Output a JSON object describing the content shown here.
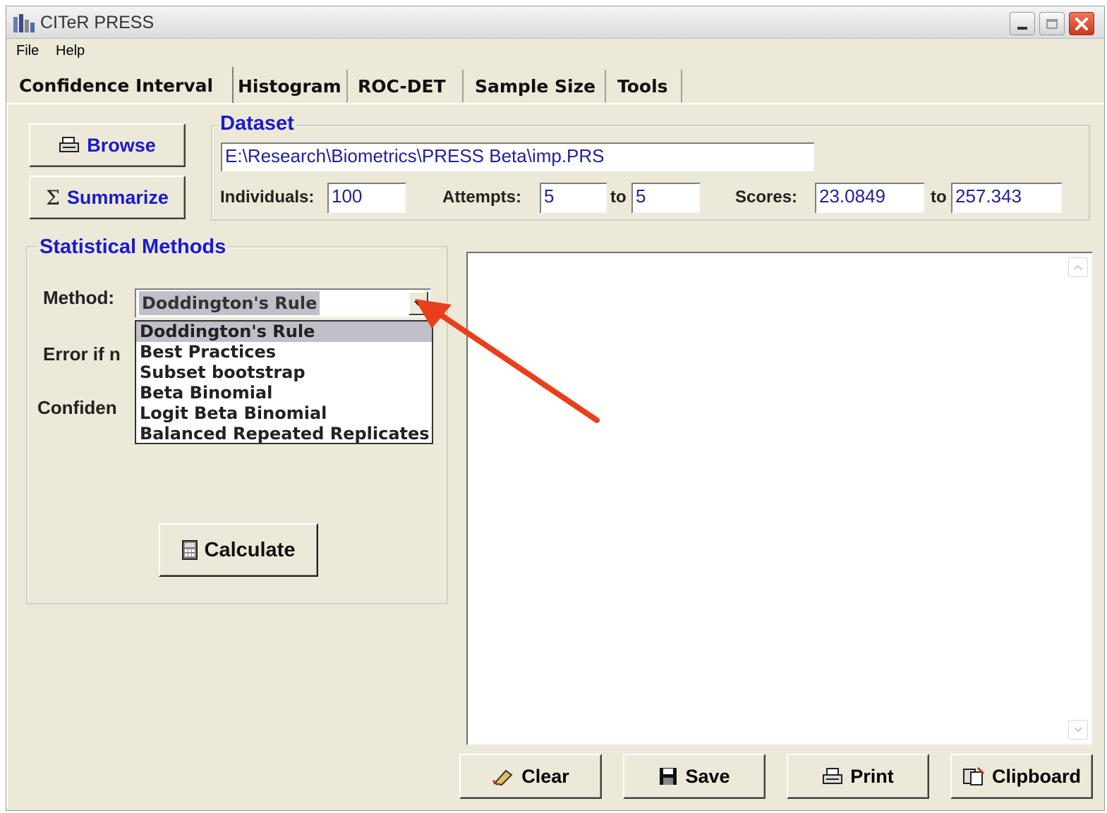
{
  "window": {
    "title": "CITeR PRESS"
  },
  "menu": {
    "items": [
      "File",
      "Help"
    ]
  },
  "tabs": [
    "Confidence Interval",
    "Histogram",
    "ROC-DET",
    "Sample Size",
    "Tools"
  ],
  "buttons": {
    "browse": "Browse",
    "summarize": "Summarize",
    "calculate": "Calculate",
    "clear": "Clear",
    "save": "Save",
    "print": "Print",
    "clipboard": "Clipboard"
  },
  "dataset": {
    "title": "Dataset",
    "path": "E:\\Research\\Biometrics\\PRESS Beta\\imp.PRS",
    "individuals_label": "Individuals:",
    "individuals": "100",
    "attempts_label": "Attempts:",
    "attempts_from": "5",
    "to_label": "to",
    "attempts_to": "5",
    "scores_label": "Scores:",
    "scores_from": "23.0849",
    "scores_to": "257.343"
  },
  "methods": {
    "title": "Statistical Methods",
    "method_label": "Method:",
    "selected": "Doddington's Rule",
    "error_label_partial": "Error if n",
    "confidence_label_partial": "Confiden",
    "options": [
      "Doddington's Rule",
      "Best Practices",
      "Subset bootstrap",
      "Beta Binomial",
      "Logit Beta Binomial",
      "Balanced Repeated Replicates"
    ]
  },
  "colors": {
    "accent_title": "#1a1ad0",
    "field_text": "#2020a0",
    "annotation_arrow": "#e8401c"
  },
  "icons": [
    "app-icon",
    "printer-icon",
    "sigma-icon",
    "calculator-icon",
    "eraser-icon",
    "floppy-icon",
    "print-icon",
    "clipboard-icon"
  ]
}
